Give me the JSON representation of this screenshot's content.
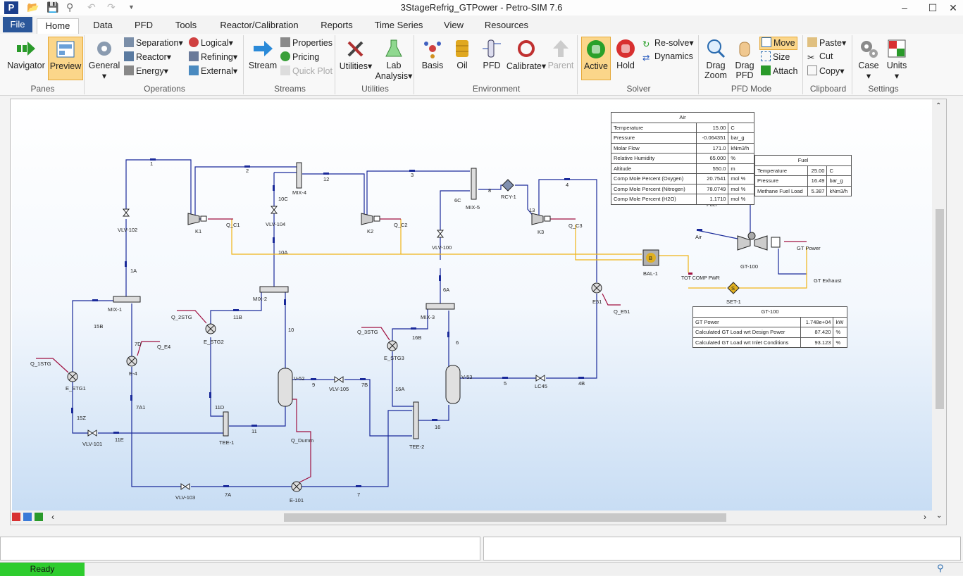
{
  "window": {
    "title": "3StageRefrig_GTPower - Petro-SIM 7.6",
    "logo": "P"
  },
  "menu": {
    "file": "File",
    "tabs": [
      "Home",
      "Data",
      "PFD",
      "Tools",
      "Reactor/Calibration",
      "Reports",
      "Time Series",
      "View",
      "Resources"
    ]
  },
  "ribbon": {
    "panes": {
      "label": "Panes",
      "navigator": "Navigator",
      "preview": "Preview"
    },
    "operations": {
      "label": "Operations",
      "general": "General",
      "separation": "Separation",
      "reactor": "Reactor",
      "energy": "Energy",
      "logical": "Logical",
      "refining": "Refining",
      "external": "External"
    },
    "streams": {
      "label": "Streams",
      "stream": "Stream",
      "properties": "Properties",
      "pricing": "Pricing",
      "quick_plot": "Quick Plot"
    },
    "utilities": {
      "label": "Utilities",
      "utilities": "Utilities",
      "lab_analysis": "Lab Analysis"
    },
    "environment": {
      "label": "Environment",
      "basis": "Basis",
      "oil": "Oil",
      "pfd": "PFD",
      "calibrate": "Calibrate",
      "parent": "Parent"
    },
    "solver": {
      "label": "Solver",
      "active": "Active",
      "hold": "Hold",
      "resolve": "Re-solve",
      "dynamics": "Dynamics"
    },
    "pfd_mode": {
      "label": "PFD Mode",
      "drag_zoom": "Drag Zoom",
      "drag_pfd": "Drag PFD",
      "move": "Move",
      "size": "Size",
      "attach": "Attach"
    },
    "clipboard": {
      "label": "Clipboard",
      "paste": "Paste",
      "cut": "Cut",
      "copy": "Copy"
    },
    "settings": {
      "label": "Settings",
      "case": "Case",
      "units": "Units"
    }
  },
  "pfd": {
    "labels": {
      "s1": "1",
      "s2": "2",
      "s3": "3",
      "s4": "4",
      "s12": "12",
      "s8": "8",
      "s6c": "6C",
      "s10c": "10C",
      "s10a": "10A",
      "s1a": "1A",
      "s15b": "15B",
      "s11b": "11B",
      "s10": "10",
      "s7d": "7D",
      "s6a": "6A",
      "s6": "6",
      "s16b": "16B",
      "s9": "9",
      "s7b": "7B",
      "s16a": "16A",
      "s5": "5",
      "s4b": "4B",
      "s15z": "15Z",
      "s11e": "11E",
      "s7a1": "7A1",
      "s11d": "11D",
      "s11": "11",
      "s16": "16",
      "s7a": "7A",
      "s7": "7",
      "s13": "13",
      "vlv102": "VLV-102",
      "vlv104": "VLV-104",
      "vlv100": "VLV-100",
      "vlv105": "VLV-105",
      "vlv101": "VLV-101",
      "vlv103": "VLV-103",
      "lc45": "LC45",
      "k1": "K1",
      "k2": "K2",
      "k3": "K3",
      "qc1": "Q_C1",
      "qc2": "Q_C2",
      "qc3": "Q_C3",
      "mix1": "MIX-1",
      "mix2": "MIX-2",
      "mix3": "MIX-3",
      "mix4": "MIX-4",
      "mix5": "MIX-5",
      "rcy1": "RCY-1",
      "q2stg": "Q_2STG",
      "q3stg": "Q_3STG",
      "q1stg": "Q_1STG",
      "qe4": "Q_E4",
      "qe51": "Q_E51",
      "qdumm": "Q_Dumm",
      "estg1": "E_STG1",
      "estg2": "E_STG2",
      "estg3": "E_STG3",
      "e4": "E-4",
      "e51": "E51",
      "e101": "E-101",
      "v52": "V-52",
      "v53": "V-53",
      "tee1": "TEE-1",
      "tee2": "TEE-2",
      "bal1": "BAL-1",
      "bal_b": "B",
      "totcomp": "TOT COMP PWR",
      "set1": "SET-1",
      "set_s": "S",
      "air": "Air",
      "fuel": "Fuel",
      "gt100": "GT-100",
      "gtpower": "GT Power",
      "gtexhaust": "GT Exhaust"
    },
    "air_table": {
      "title": "Air",
      "rows": [
        [
          "Temperature",
          "15.00",
          "C"
        ],
        [
          "Pressure",
          "-0.064351",
          "bar_g"
        ],
        [
          "Molar Flow",
          "171.0",
          "kNm3/h"
        ],
        [
          "Relative Humidity",
          "65.000",
          "%"
        ],
        [
          "Altitude",
          "550.0",
          "m"
        ],
        [
          "Comp Mole Percent (Oxygen)",
          "20.7541",
          "mol %"
        ],
        [
          "Comp Mole Percent (Nitrogen)",
          "78.0749",
          "mol %"
        ],
        [
          "Comp Mole Percent (H2O)",
          "1.1710",
          "mol %"
        ]
      ]
    },
    "fuel_table": {
      "title": "Fuel",
      "rows": [
        [
          "Temperature",
          "25.00",
          "C"
        ],
        [
          "Pressure",
          "16.49",
          "bar_g"
        ],
        [
          "Methane Fuel Load",
          "5.387",
          "kNm3/h"
        ]
      ]
    },
    "gt_table": {
      "title": "GT-100",
      "rows": [
        [
          "GT Power",
          "1.748e+04",
          "kW"
        ],
        [
          "Calculated GT Load wrt Design Power",
          "87.420",
          "%"
        ],
        [
          "Calculated GT Load wrt Inlet Conditions",
          "93.123",
          "%"
        ]
      ]
    }
  },
  "status": {
    "ready": "Ready"
  }
}
